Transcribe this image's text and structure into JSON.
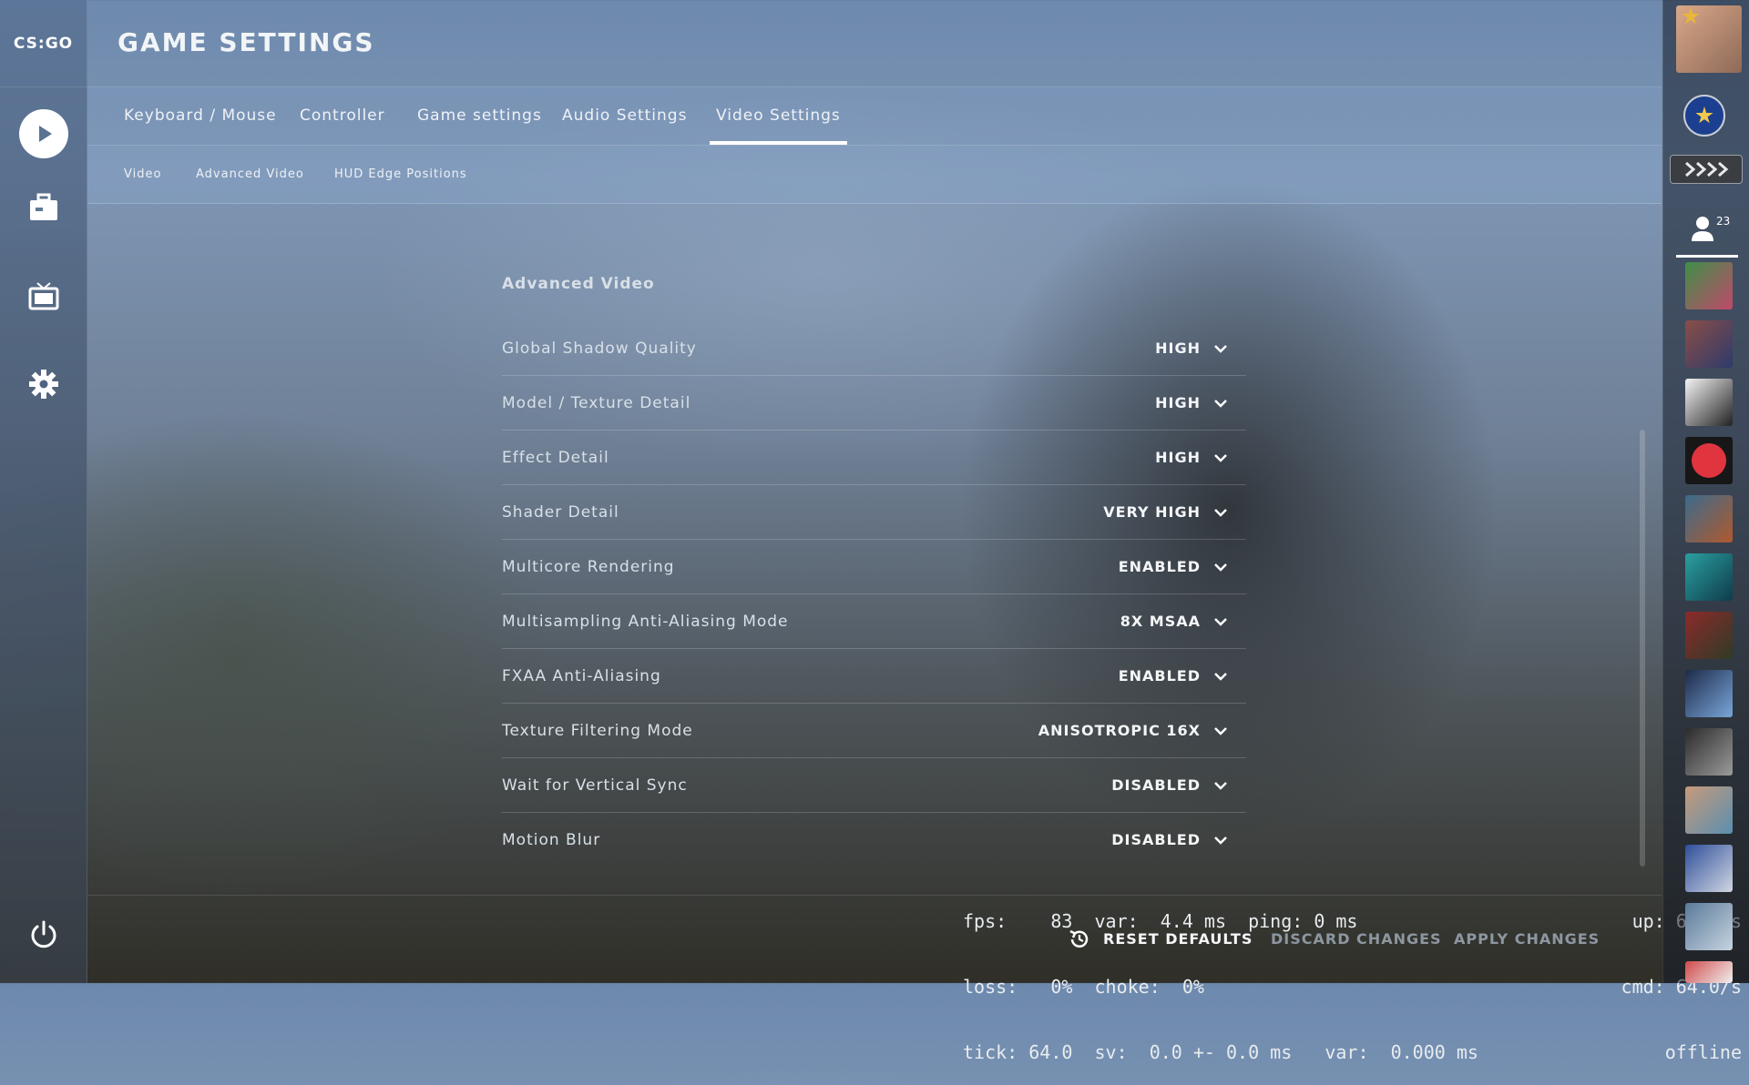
{
  "app": {
    "logo": "CS:GO"
  },
  "header": {
    "title": "GAME SETTINGS"
  },
  "tabs": [
    {
      "label": "Keyboard / Mouse"
    },
    {
      "label": "Controller"
    },
    {
      "label": "Game settings"
    },
    {
      "label": "Audio Settings"
    },
    {
      "label": "Video Settings",
      "active": true
    }
  ],
  "subtabs": [
    {
      "label": "Video"
    },
    {
      "label": "Advanced Video",
      "active": true
    },
    {
      "label": "HUD Edge Positions"
    }
  ],
  "section": {
    "title": "Advanced Video"
  },
  "settings": [
    {
      "label": "Global Shadow Quality",
      "value": "HIGH"
    },
    {
      "label": "Model / Texture Detail",
      "value": "HIGH"
    },
    {
      "label": "Effect Detail",
      "value": "HIGH"
    },
    {
      "label": "Shader Detail",
      "value": "VERY HIGH"
    },
    {
      "label": "Multicore Rendering",
      "value": "ENABLED"
    },
    {
      "label": "Multisampling Anti-Aliasing Mode",
      "value": "8X MSAA"
    },
    {
      "label": "FXAA Anti-Aliasing",
      "value": "ENABLED"
    },
    {
      "label": "Texture Filtering Mode",
      "value": "ANISOTROPIC 16X"
    },
    {
      "label": "Wait for Vertical Sync",
      "value": "DISABLED"
    },
    {
      "label": "Motion Blur",
      "value": "DISABLED"
    }
  ],
  "netgraph": {
    "line1": "fps:    83  var:  4.4 ms  ping: 0 ms",
    "line2": "loss:   0%  choke:  0%",
    "line3": "tick: 64.0  sv:  0.0 +- 0.0 ms   var:  0.000 ms",
    "right1": "up: 64.0/s",
    "right2": "cmd: 64.0/s",
    "right3": "offline"
  },
  "footer": {
    "reset": "RESET DEFAULTS",
    "discard": "DISCARD CHANGES",
    "apply": "APPLY CHANGES"
  },
  "friends": {
    "count": "23"
  },
  "colors": {
    "accent": "#ffffff",
    "disabled_text": "#8d97a1",
    "rank_badge": "#1d3f8f"
  }
}
